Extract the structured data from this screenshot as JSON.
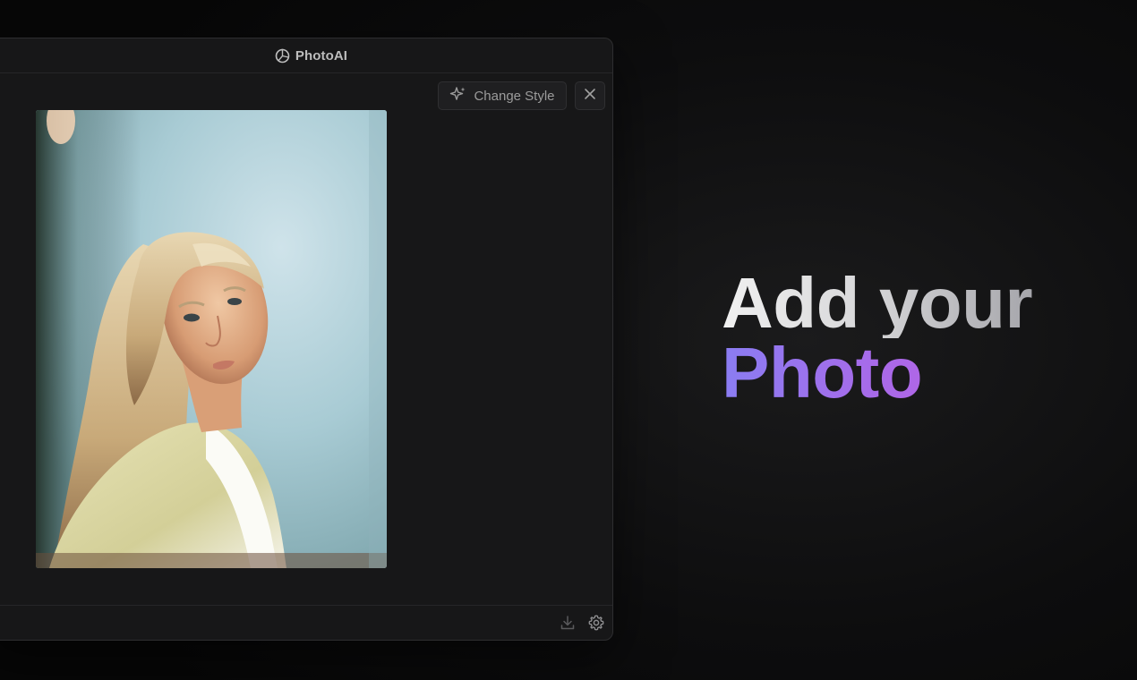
{
  "window": {
    "app_title": "PhotoAI",
    "toolbar": {
      "change_style_label": "Change Style"
    },
    "footer": {
      "icons": [
        "download-icon",
        "gear-icon"
      ]
    },
    "photo": {
      "description_icon": "portrait-photo"
    }
  },
  "hero": {
    "line1": "Add your",
    "line2": "Photo"
  },
  "colors": {
    "background": "#0d0d0e",
    "window_bg": "#171718",
    "accent_start": "#8a7df2",
    "accent_end": "#c05ee2"
  }
}
